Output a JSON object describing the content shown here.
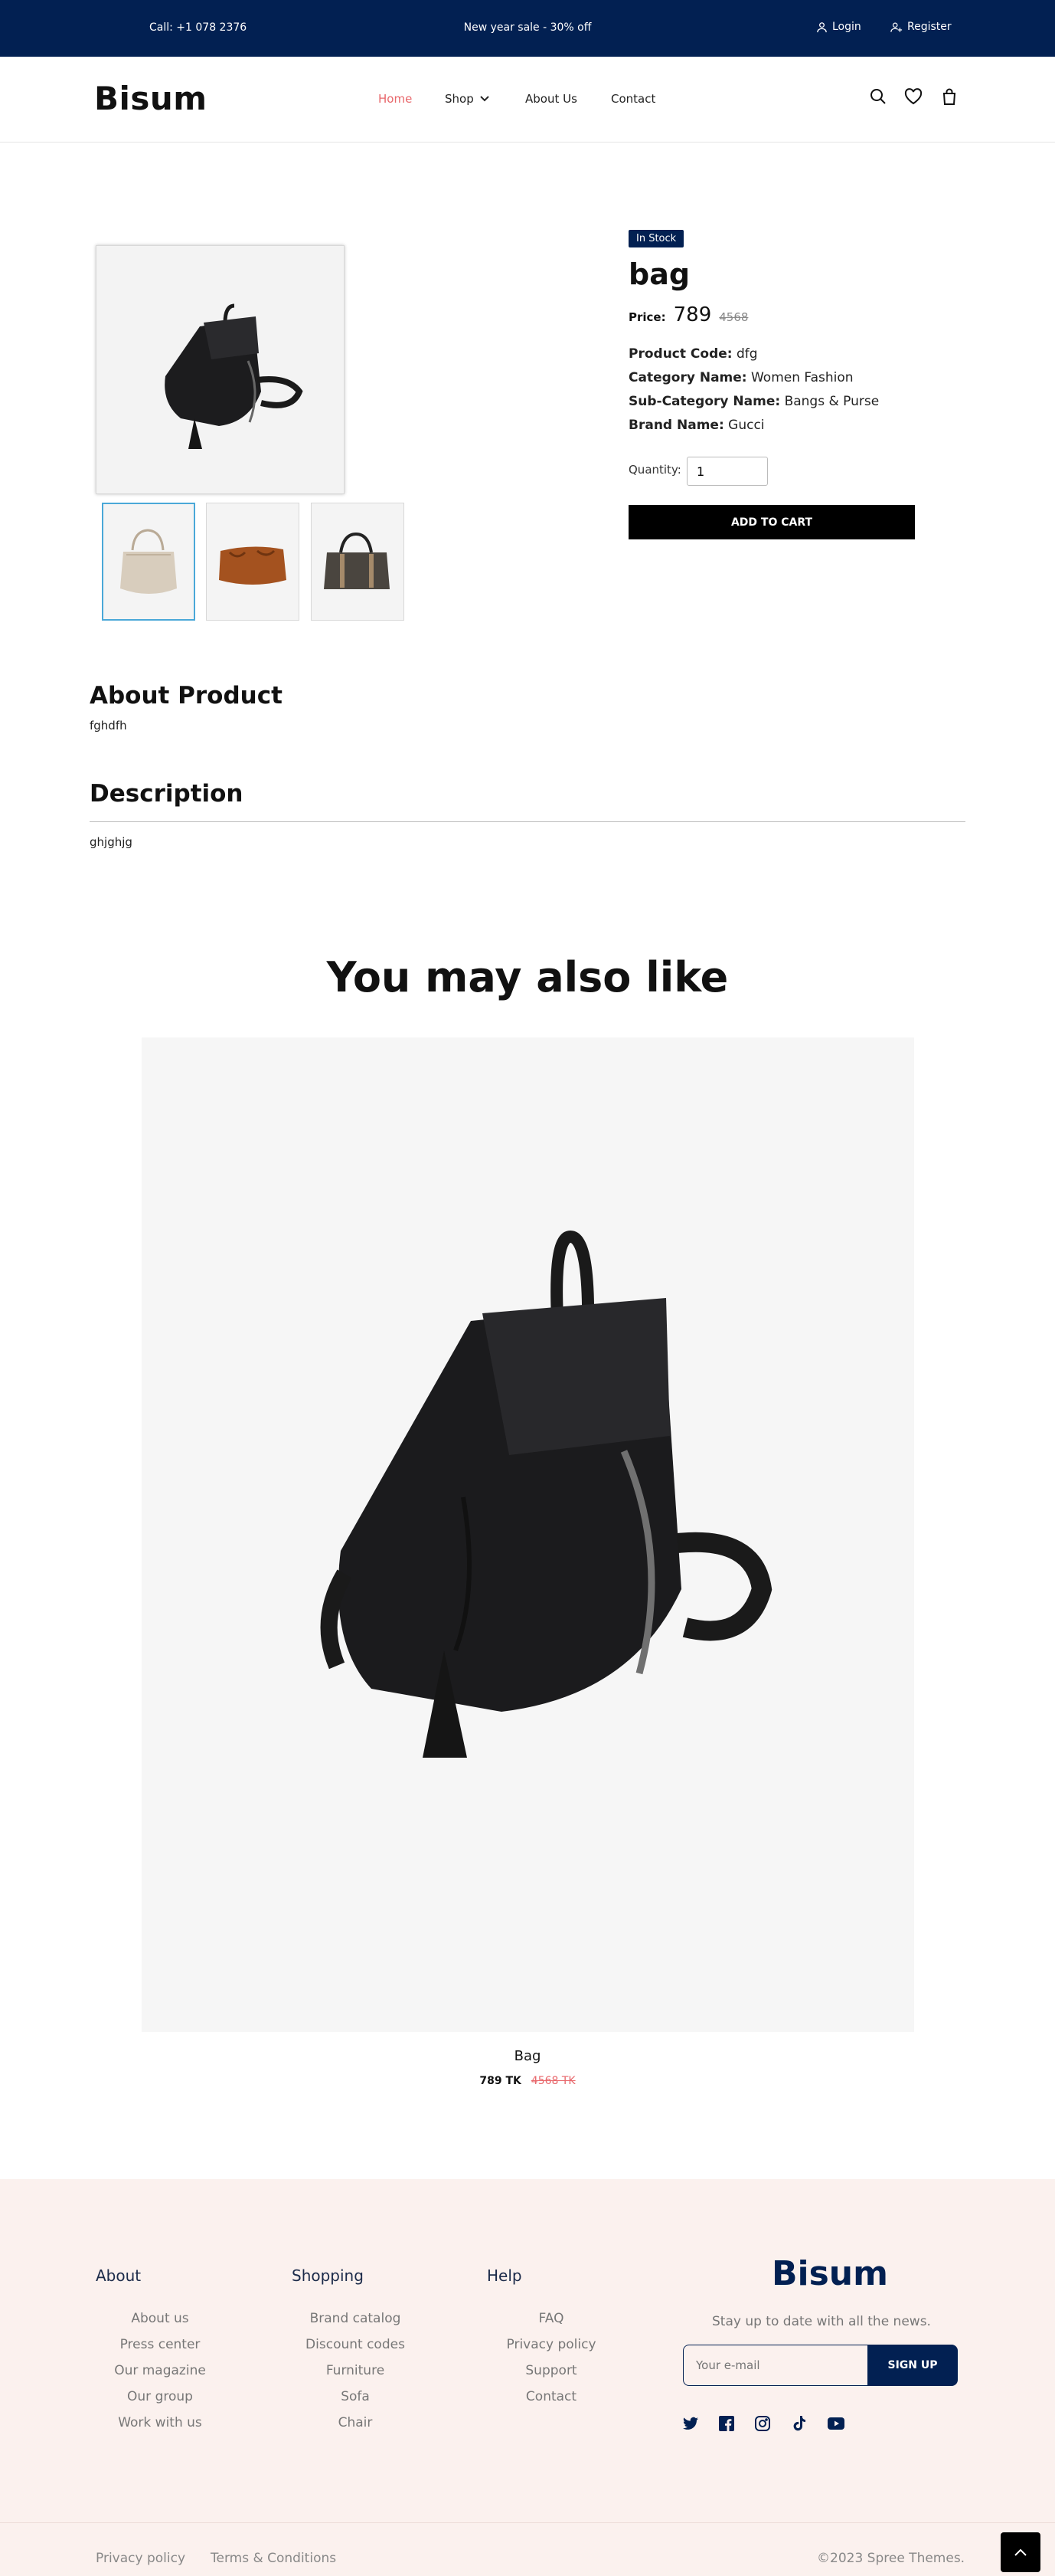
{
  "topbar": {
    "call": "Call: +1 078 2376",
    "promo": "New year sale - 30% off",
    "login": "Login",
    "register": "Register"
  },
  "header": {
    "logo": "Bisum",
    "nav": [
      "Home",
      "Shop",
      "About Us",
      "Contact"
    ],
    "icons": [
      "search-icon",
      "heart-icon",
      "bag-icon"
    ]
  },
  "product": {
    "badge": "In Stock",
    "title": "bag",
    "price_label": "Price:",
    "price": "789",
    "old_price": "4568",
    "code_label": "Product Code:",
    "code": "dfg",
    "category_label": "Category Name:",
    "category": "Women Fashion",
    "subcategory_label": "Sub-Category Name:",
    "subcategory": "Bangs & Purse",
    "brand_label": "Brand Name:",
    "brand": "Gucci",
    "quantity_label": "Quantity:",
    "quantity": "1",
    "add_to_cart": "ADD TO CART"
  },
  "about": {
    "heading": "About Product",
    "text": "fghdfh"
  },
  "description": {
    "heading": "Description",
    "text": "ghjghjg"
  },
  "related": {
    "heading": "You may also like",
    "items": [
      {
        "name": "Bag",
        "price": "789 TK",
        "old_price": "4568 TK"
      }
    ]
  },
  "footer": {
    "about": {
      "heading": "About",
      "links": [
        "About us",
        "Press center",
        "Our magazine",
        "Our group",
        "Work with us"
      ]
    },
    "shopping": {
      "heading": "Shopping",
      "links": [
        "Brand catalog",
        "Discount codes",
        "Furniture",
        "Sofa",
        "Chair"
      ]
    },
    "help": {
      "heading": "Help",
      "links": [
        "FAQ",
        "Privacy policy",
        "Support",
        "Contact"
      ]
    },
    "logo": "Bisum",
    "tagline": "Stay up to date with all the news.",
    "email_placeholder": "Your e-mail",
    "signup": "SIGN UP",
    "social": [
      "twitter-icon",
      "facebook-icon",
      "instagram-icon",
      "tiktok-icon",
      "youtube-icon"
    ],
    "privacy": "Privacy policy",
    "terms": "Terms & Conditions",
    "copyright": "©2023 Spree Themes."
  },
  "colors": {
    "navy": "#022052",
    "accent": "#e8676b",
    "footer_bg": "#fbf1ee"
  }
}
